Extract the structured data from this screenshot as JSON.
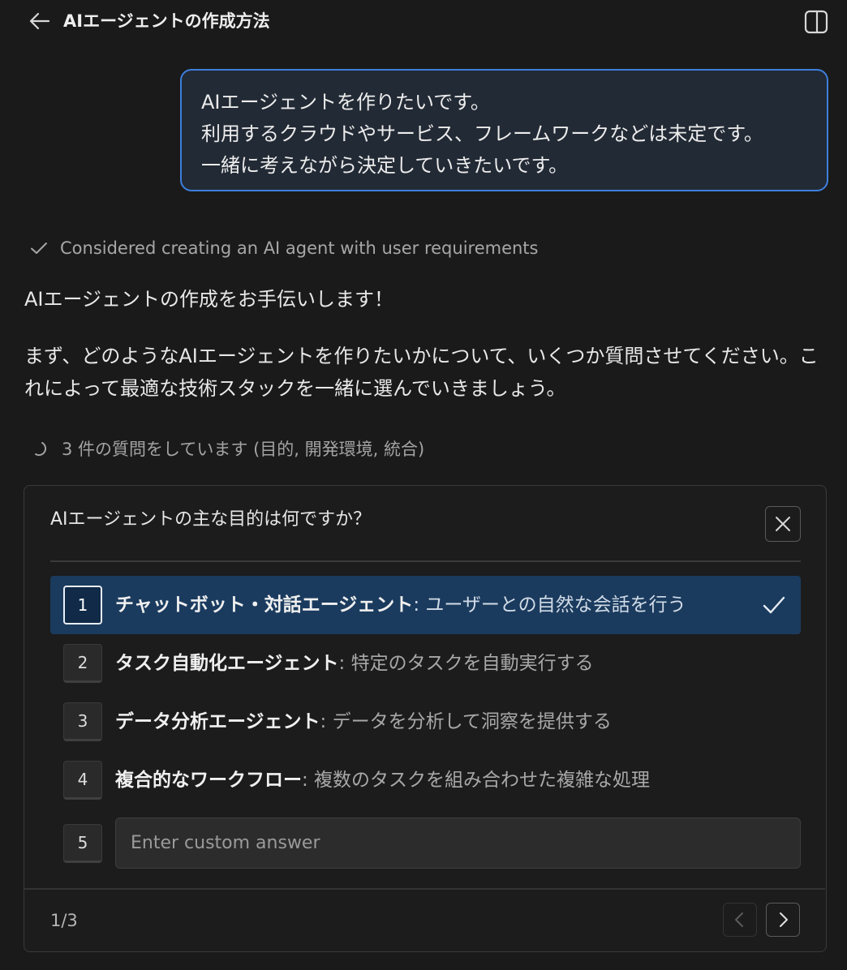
{
  "header": {
    "title": "AIエージェントの作成方法",
    "back_icon": "arrow-left-icon",
    "panel_icon": "sidebar-toggle-icon"
  },
  "user_message": {
    "lines": [
      "AIエージェントを作りたいです。",
      "利用するクラウドやサービス、フレームワークなどは未定です。",
      "一緒に考えながら決定していきたいです。"
    ]
  },
  "thought": {
    "label": "Considered creating an AI agent with user requirements",
    "icon": "check-icon"
  },
  "assistant": {
    "para1": "AIエージェントの作成をお手伝いします！",
    "para2": "まず、どのようなAIエージェントを作りたいかについて、いくつか質問させてください。これによって最適な技術スタックを一緒に選んでいきましょう。"
  },
  "progress": {
    "label": "3 件の質問をしています (目的, 開発環境, 統合)",
    "icon": "spinner-icon"
  },
  "question": {
    "title": "AIエージェントの主な目的は何ですか？",
    "options": [
      {
        "num": "1",
        "bold": "チャットボット・対話エージェント",
        "desc": ": ユーザーとの自然な会話を行う",
        "selected": true
      },
      {
        "num": "2",
        "bold": "タスク自動化エージェント",
        "desc": ": 特定のタスクを自動実行する",
        "selected": false
      },
      {
        "num": "3",
        "bold": "データ分析エージェント",
        "desc": ": データを分析して洞察を提供する",
        "selected": false
      },
      {
        "num": "4",
        "bold": "複合的なワークフロー",
        "desc": ": 複数のタスクを組み合わせた複雑な処理",
        "selected": false
      }
    ],
    "custom": {
      "num": "5",
      "placeholder": "Enter custom answer",
      "value": ""
    },
    "pager": "1/3"
  },
  "colors": {
    "background": "#1a1a1a",
    "bubble_border": "#3d7fdc",
    "selected_option": "#1b3b5e"
  }
}
